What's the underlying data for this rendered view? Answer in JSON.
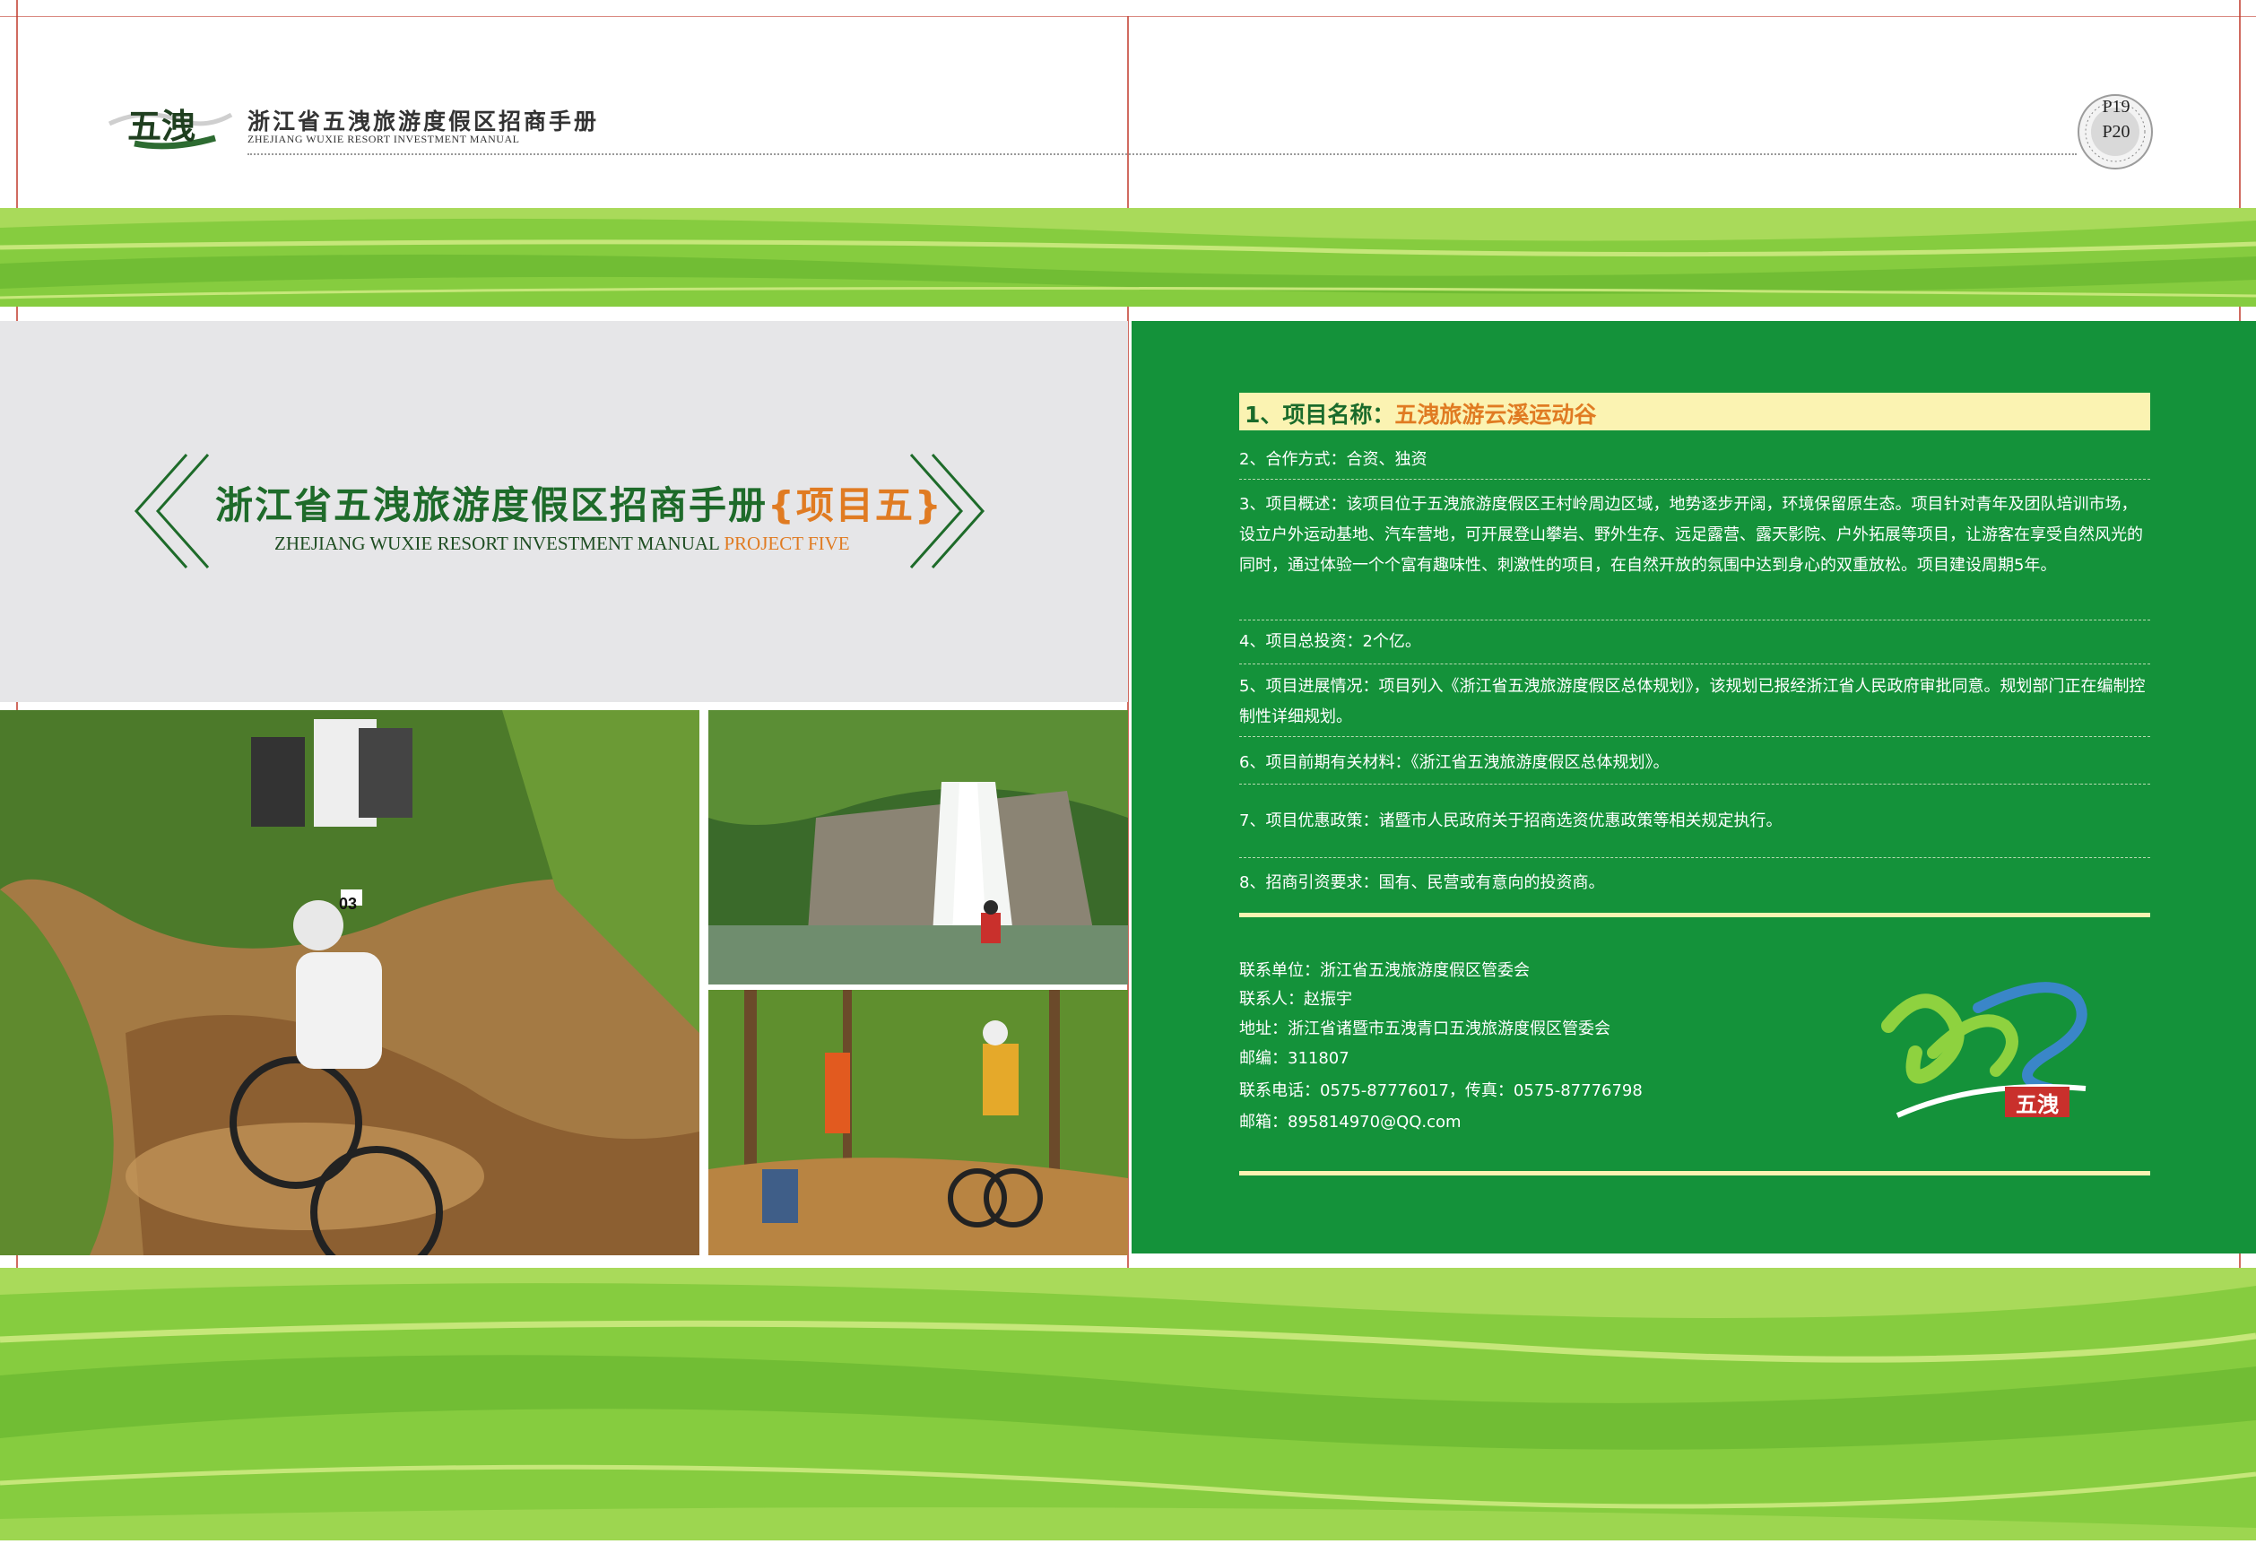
{
  "header": {
    "title": "浙江省五洩旅游度假区招商手册",
    "subtitle": "ZHEJIANG WUXIE RESORT INVESTMENT MANUAL",
    "logo_text": "五洩",
    "page_left": "P19",
    "page_right": "P20",
    "badge_ring_text": "ZHEJIANG WUXIE RESORT INVESTMENT MANUAL"
  },
  "left": {
    "main_title": "浙江省五洩旅游度假区招商手册",
    "main_title_highlight": "{项目五}",
    "main_sub": "ZHEJIANG WUXIE RESORT INVESTMENT MANUAL",
    "main_sub_highlight": "PROJECT FIVE",
    "photos": [
      "mountain-bike-photo",
      "waterfall-photo",
      "forest-bike-photo"
    ],
    "bike_number": "03"
  },
  "right": {
    "item1_label": "1、项目名称：",
    "item1_value": "五洩旅游云溪运动谷",
    "items": [
      "2、合作方式：合资、独资",
      "3、项目概述：该项目位于五洩旅游度假区王村岭周边区域，地势逐步开阔，环境保留原生态。项目针对青年及团队培训市场，设立户外运动基地、汽车营地，可开展登山攀岩、野外生存、远足露营、露天影院、户外拓展等项目，让游客在享受自然风光的同时，通过体验一个个富有趣味性、刺激性的项目，在自然开放的氛围中达到身心的双重放松。项目建设周期5年。",
      "4、项目总投资：2个亿。",
      "5、项目进展情况：项目列入《浙江省五洩旅游度假区总体规划》，该规划已报经浙江省人民政府审批同意。规划部门正在编制控制性详细规划。",
      "6、项目前期有关材料：《浙江省五洩旅游度假区总体规划》。",
      "7、项目优惠政策：诸暨市人民政府关于招商选资优惠政策等相关规定执行。",
      "8、招商引资要求：国有、民营或有意向的投资商。"
    ],
    "contacts": [
      "联系单位：浙江省五洩旅游度假区管委会",
      "联系人：赵振宇",
      "地址：浙江省诸暨市五洩青口五洩旅游度假区管委会",
      "邮编：311807",
      "联系电话：0575-87776017，传真：0575-87776798",
      "邮箱：895814970@QQ.com"
    ],
    "brand_logo_text": "五洩"
  },
  "colors": {
    "dark_green": "#14923a",
    "title_green": "#1e6b2a",
    "orange": "#e07b22",
    "pale_yellow": "#fbf3b2",
    "band_green": "#7fc93a"
  }
}
